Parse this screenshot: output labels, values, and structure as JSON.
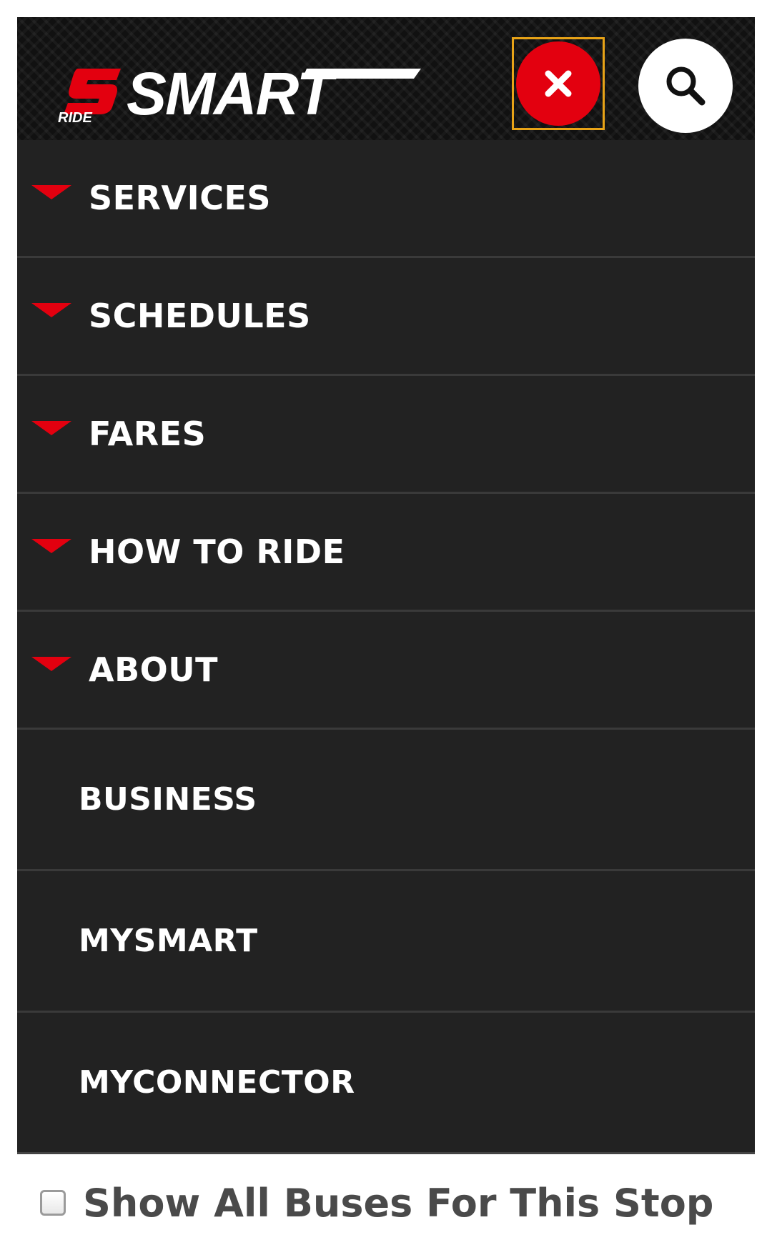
{
  "header": {
    "logo_text": "SMART",
    "logo_subtext": "RIDE",
    "close_icon": "close-icon",
    "search_icon": "search-icon",
    "brand_red": "#e3000f",
    "focus_outline": "#e8a317"
  },
  "menu": {
    "items": [
      {
        "label": "SERVICES",
        "expandable": true
      },
      {
        "label": "SCHEDULES",
        "expandable": true
      },
      {
        "label": "FARES",
        "expandable": true
      },
      {
        "label": "HOW TO RIDE",
        "expandable": true
      },
      {
        "label": "ABOUT",
        "expandable": true
      },
      {
        "label": "BUSINESS",
        "expandable": false
      },
      {
        "label": "MYSMART",
        "expandable": false
      },
      {
        "label": "MYCONNECTOR",
        "expandable": false
      }
    ]
  },
  "footer": {
    "checkbox_label": "Show All Buses For This Stop",
    "checked": false
  }
}
